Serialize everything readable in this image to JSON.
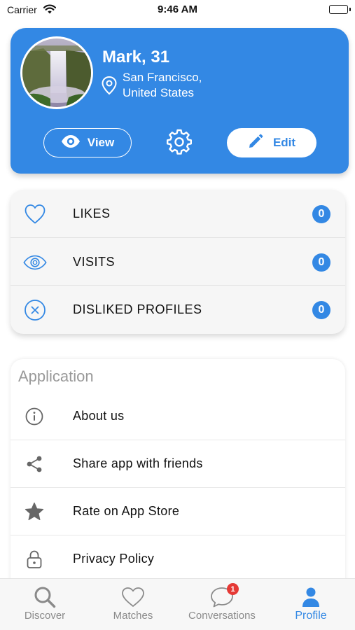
{
  "status_bar": {
    "carrier": "Carrier",
    "time": "9:46 AM"
  },
  "profile": {
    "name": "Mark, 31",
    "location_line1": "San Francisco,",
    "location_line2": "United States",
    "view_label": "View",
    "edit_label": "Edit",
    "accent_color": "#3388e4"
  },
  "stats": [
    {
      "label": "LIKES",
      "count": "0",
      "icon": "heart-outline-icon"
    },
    {
      "label": "VISITS",
      "count": "0",
      "icon": "eye-outline-icon"
    },
    {
      "label": "DISLIKED PROFILES",
      "count": "0",
      "icon": "close-circle-icon"
    }
  ],
  "application": {
    "title": "Application",
    "items": [
      {
        "label": "About us",
        "icon": "info-icon"
      },
      {
        "label": "Share app with friends",
        "icon": "share-icon"
      },
      {
        "label": "Rate on App Store",
        "icon": "star-icon"
      },
      {
        "label": "Privacy Policy",
        "icon": "lock-icon"
      }
    ]
  },
  "tabs": [
    {
      "label": "Discover",
      "icon": "search-icon"
    },
    {
      "label": "Matches",
      "icon": "heart-icon"
    },
    {
      "label": "Conversations",
      "icon": "chat-icon",
      "badge": "1"
    },
    {
      "label": "Profile",
      "icon": "person-icon",
      "active": true
    }
  ]
}
